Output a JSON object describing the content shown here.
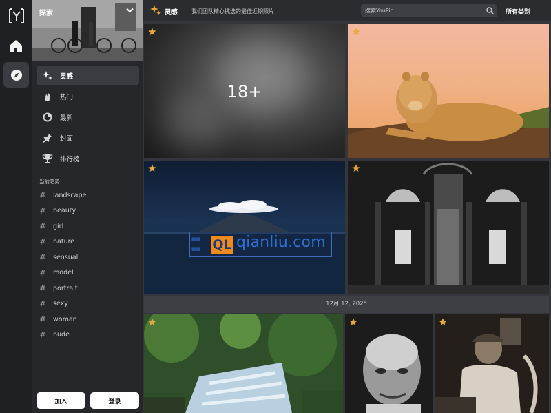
{
  "rail": {
    "logo": "[Y]",
    "items": [
      {
        "name": "home",
        "icon": "home-icon"
      },
      {
        "name": "explore",
        "icon": "compass-icon"
      }
    ]
  },
  "sidebar": {
    "hero_label": "探索",
    "nav": [
      {
        "label": "灵感",
        "icon": "sparkles-icon",
        "active": true
      },
      {
        "label": "热门",
        "icon": "flame-icon",
        "active": false
      },
      {
        "label": "最新",
        "icon": "clock-icon",
        "active": false
      },
      {
        "label": "封面",
        "icon": "pin-icon",
        "active": false
      },
      {
        "label": "排行榜",
        "icon": "trophy-icon",
        "active": false
      }
    ],
    "trending_title": "当前趋势",
    "tags": [
      "landscape",
      "beauty",
      "girl",
      "nature",
      "sensual",
      "model",
      "portrait",
      "sexy",
      "woman",
      "nude"
    ],
    "join_label": "加入",
    "login_label": "登录"
  },
  "topbar": {
    "title": "灵感",
    "description": "我们团队精心挑选的最佳近期照片",
    "search_placeholder": "搜索YouPic",
    "category_label": "所有类别"
  },
  "feed": {
    "age_label": "18+",
    "date_separator": "12月 12, 2025",
    "watermark_brand": "QL",
    "watermark_text": "qianliu.com",
    "accent_star": "#e8a93b"
  }
}
